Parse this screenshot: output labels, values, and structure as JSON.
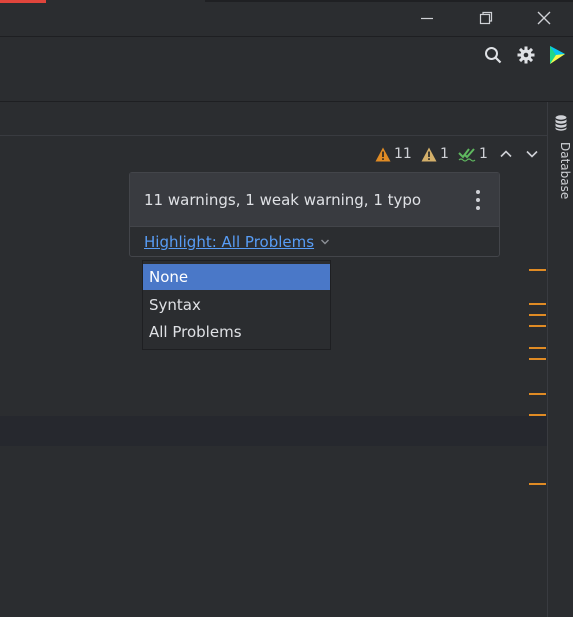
{
  "window": {
    "buttons": [
      "minimize",
      "restore",
      "close"
    ]
  },
  "toolbar": {
    "icons": [
      "search-icon",
      "gear-icon",
      "jetbrains-ai-icon"
    ]
  },
  "sidebar": {
    "database_label": "Database"
  },
  "inspections": {
    "warnings_count": "11",
    "weak_warnings_count": "1",
    "typos_count": "1"
  },
  "popup": {
    "summary": "11 warnings, 1 weak warning, 1 typo",
    "highlight_link": "Highlight: All Problems"
  },
  "dropdown": {
    "options": [
      "None",
      "Syntax",
      "All Problems"
    ],
    "selected": "None"
  },
  "colors": {
    "accent_link": "#589df6",
    "selection": "#4a78c8",
    "warning": "#e08b24",
    "typo_check": "#5fb85f"
  }
}
